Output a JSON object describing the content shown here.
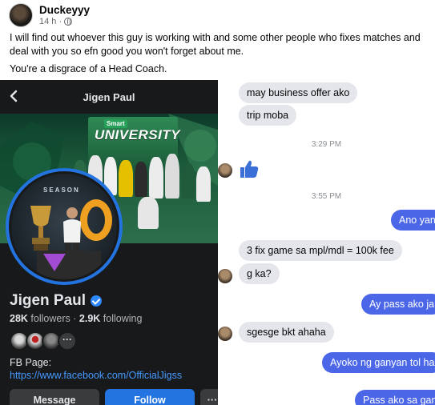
{
  "post": {
    "author": "Duckeyyy",
    "time": "14 h ·",
    "body": "I will find out whoever this guy is working with and some other people who fixes matches and deal with you so efn good you won't forget about me.",
    "body2": "You're a disgrace of a Head Coach."
  },
  "profile": {
    "title": "Jigen Paul",
    "cover_brand": "Smart",
    "cover_word": "UNIVERSITY",
    "avatar_text": "SEASON",
    "name": "Jigen Paul",
    "followers_count": "28K",
    "followers_label": "followers",
    "separator": "·",
    "following_count": "2.9K",
    "following_label": "following",
    "more_friends": "···",
    "fb_page_label": "FB Page:",
    "fb_page_link": "https://www.facebook.com/OfficialJigss",
    "message_button": "Message",
    "follow_button": "Follow",
    "more_button": "···"
  },
  "chat": {
    "messages": [
      {
        "side": "in",
        "text": "may business offer ako"
      },
      {
        "side": "in",
        "text": "trip moba"
      },
      {
        "side": "time",
        "text": "3:29 PM"
      },
      {
        "side": "in-like"
      },
      {
        "side": "time",
        "text": "3:55 PM"
      },
      {
        "side": "out",
        "text": "Ano yan"
      },
      {
        "side": "in",
        "text": "3 fix game sa mpl/mdl = 100k fee"
      },
      {
        "side": "in",
        "text": "g ka?"
      },
      {
        "side": "out",
        "text": "Ay pass ako ja"
      },
      {
        "side": "in",
        "text": "sgesge bkt ahaha"
      },
      {
        "side": "out",
        "text": "Ayoko ng ganyan tol ha"
      },
      {
        "side": "out",
        "text": "Pass ako sa gan"
      }
    ]
  },
  "colors": {
    "outgoing_bubble": "#4b67e8",
    "incoming_bubble": "#e4e6eb",
    "profile_bg": "#18191a",
    "follow_button": "#2374e1",
    "link": "#4599ff"
  }
}
